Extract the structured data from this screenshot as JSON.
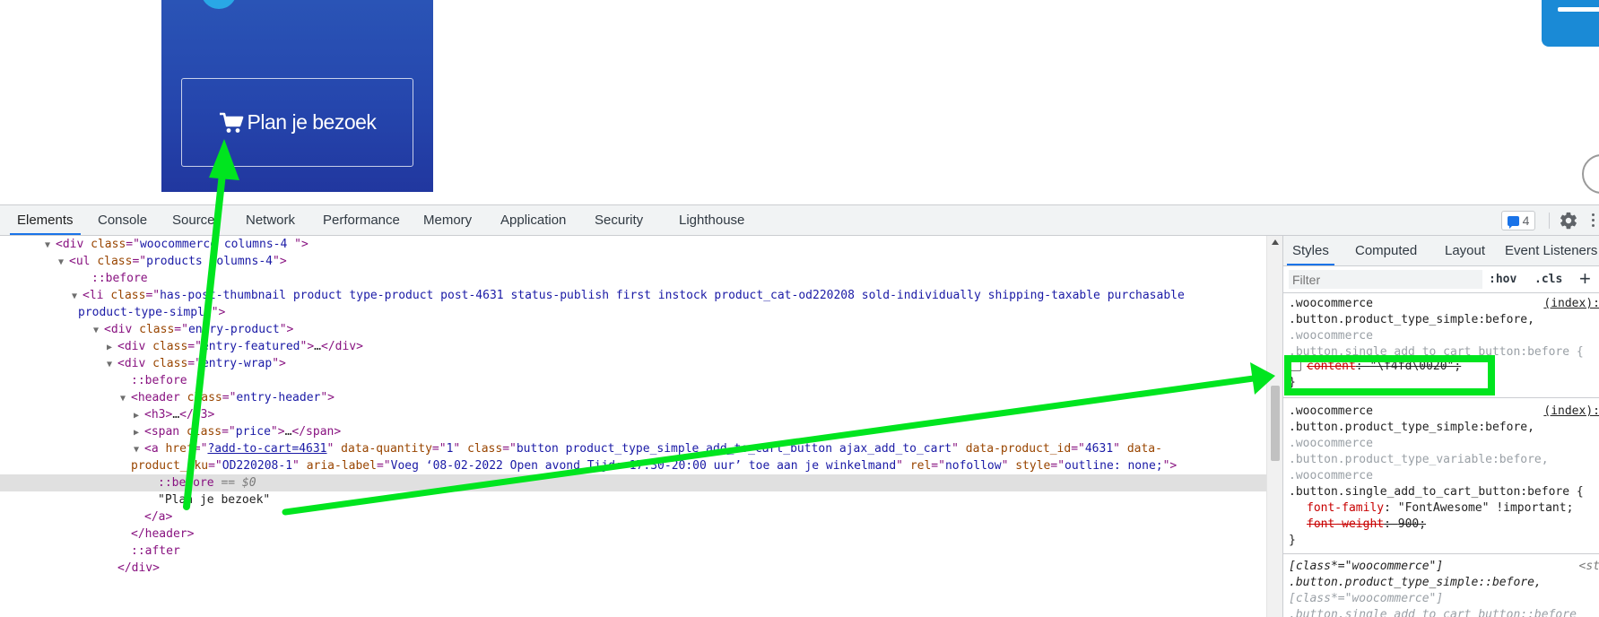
{
  "page": {
    "visit_button_label": "Plan je bezoek"
  },
  "devtools": {
    "tabs": [
      "Elements",
      "Console",
      "Sources",
      "Network",
      "Performance",
      "Memory",
      "Application",
      "Security",
      "Lighthouse"
    ],
    "active_tab": "Elements",
    "issues_count": "4",
    "elements": {
      "line1_class": "woocommerce columns-4 ",
      "line2_class": "products columns-4",
      "before": "::before",
      "li_class_a": "has-post-thumbnail product type-product post-4631 status-publish first instock product_cat-od220208 sold-individually shipping-taxable purchasable",
      "li_class_b": "product-type-simple",
      "entry_product": "entry-product",
      "entry_featured": "entry-featured",
      "entry_wrap": "entry-wrap",
      "entry_header": "entry-header",
      "price": "price",
      "a_href": "?add-to-cart=4631",
      "a_quantity": "1",
      "a_class": "button product_type_simple add_to_cart_button ajax_add_to_cart",
      "a_product_id": "4631",
      "a_sku": "OD220208-1",
      "a_aria_label": "Voeg ‘08-02-2022 Open avond Tijd: 17:30-20:00 uur’ toe aan je winkelmand",
      "a_rel": "nofollow",
      "a_style": "outline: none;",
      "selected_pseudo": "::before",
      "selected_eq": "== $0",
      "text_node": "\"Plan je bezoek\"",
      "after": "::after"
    },
    "styles": {
      "subtabs": [
        "Styles",
        "Computed",
        "Layout",
        "Event Listeners"
      ],
      "active_subtab": "Styles",
      "filter_placeholder": "Filter",
      "hov_label": ":hov",
      "cls_label": ".cls",
      "plus_label": "+",
      "rule1": {
        "sel1": ".woocommerce",
        "sel2": ".button.product_type_simple:before,",
        "sel3": ".woocommerce",
        "sel4": ".button.single_add_to_cart_button:before {",
        "source": "(index):",
        "prop": "content",
        "value": "\"\\f4fd\\0020\";",
        "close": "}"
      },
      "rule2": {
        "sel1": ".woocommerce",
        "sel2": ".button.product_type_simple:before,",
        "sel3": ".woocommerce",
        "sel4": ".button.product_type_variable:before,",
        "sel5": ".woocommerce",
        "sel6": ".button.single_add_to_cart_button:before {",
        "source": "(index):",
        "prop1": "font-family",
        "value1": "\"FontAwesome\" !important;",
        "prop2": "font-weight",
        "value2": "900;",
        "close": "}"
      },
      "rule3": {
        "sel1": "[class*=\"woocommerce\"]",
        "sel2": ".button.product_type_simple::before,",
        "sel3": "[class*=\"woocommerce\"]",
        "sel4": ".button.single_add_to_cart_button::before",
        "source": "<st"
      }
    }
  },
  "annotation": {
    "color": "#00e51f"
  }
}
